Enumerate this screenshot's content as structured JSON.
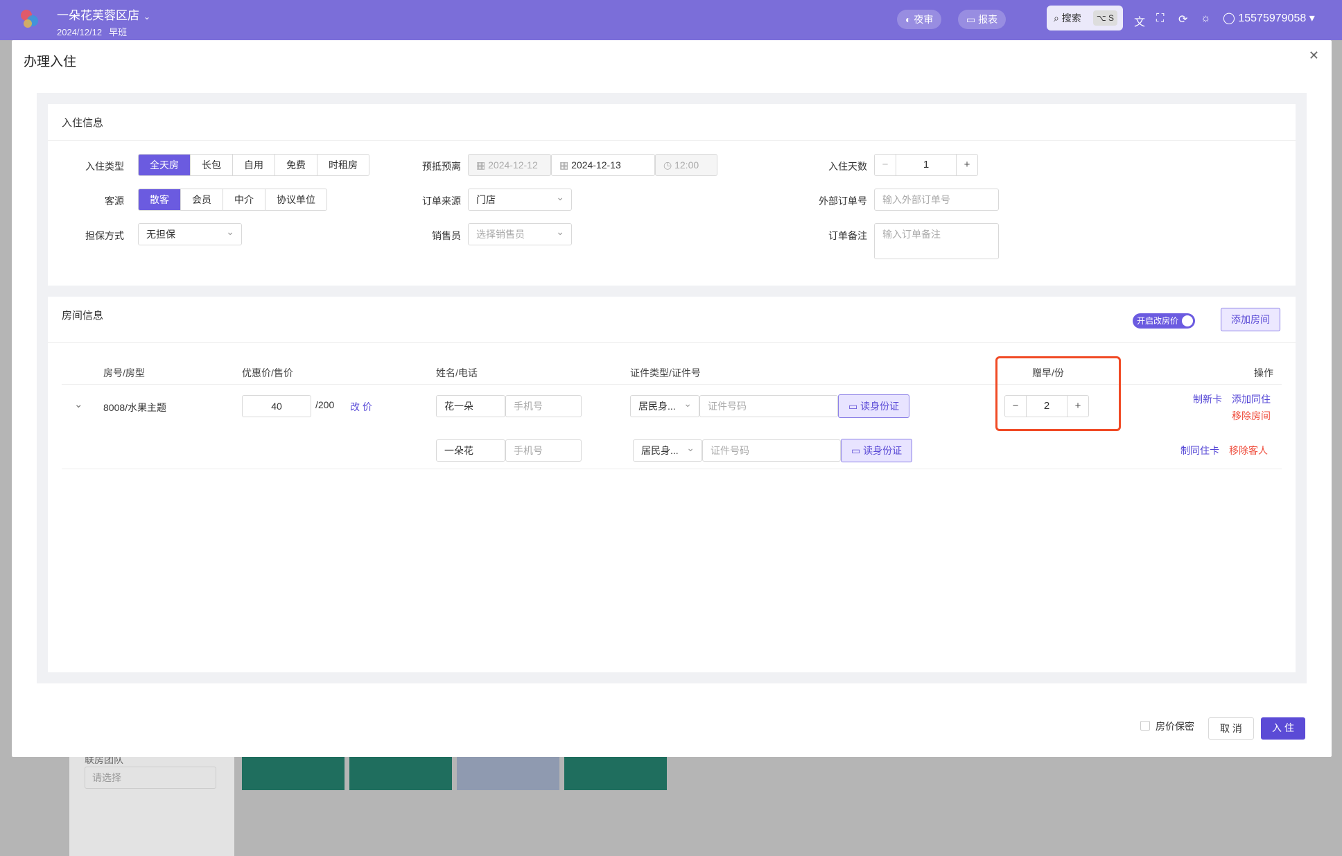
{
  "topbar": {
    "store_name": "一朵花芙蓉区店",
    "date": "2024/12/12",
    "shift": "早班",
    "night_audit_label": "夜审",
    "report_label": "报表",
    "search_label": "搜索",
    "search_shortcut": "⌥ S",
    "user_phone": "15575979058"
  },
  "background": {
    "dropdown_label": "联房团队",
    "dropdown_placeholder": "请选择"
  },
  "modal": {
    "title": "办理入住",
    "checkin_section": {
      "title": "入住信息",
      "checkin_type_label": "入住类型",
      "checkin_types": [
        "全天房",
        "长包",
        "自用",
        "免费",
        "时租房"
      ],
      "selected_checkin_type": "全天房",
      "guest_source_label": "客源",
      "guest_sources": [
        "散客",
        "会员",
        "中介",
        "协议单位"
      ],
      "selected_guest_source": "散客",
      "guarantee_label": "担保方式",
      "guarantee_value": "无担保",
      "stay_dates_label": "预抵预离",
      "arrival_date": "2024-12-12",
      "departure_date": "2024-12-13",
      "departure_time": "12:00",
      "order_source_label": "订单来源",
      "order_source_value": "门店",
      "salesperson_label": "销售员",
      "salesperson_placeholder": "选择销售员",
      "stay_days_label": "入住天数",
      "stay_days_value": "1",
      "external_order_label": "外部订单号",
      "external_order_placeholder": "输入外部订单号",
      "order_note_label": "订单备注",
      "order_note_placeholder": "输入订单备注"
    },
    "room_section": {
      "title": "房间信息",
      "modify_price_toggle_label": "开启改房价",
      "add_room_label": "添加房间",
      "columns": [
        "房号/房型",
        "优惠价/售价",
        "姓名/电话",
        "证件类型/证件号",
        "赠早/份",
        "操作"
      ],
      "room": {
        "room_name": "8008/水果主题",
        "discount_price": "40",
        "sale_price": "/200",
        "change_price_label": "改 价",
        "breakfast_count": "2",
        "make_new_card_label": "制新卡",
        "add_cohabitant_label": "添加同住",
        "remove_room_label": "移除房间"
      },
      "guests": [
        {
          "name": "花一朵",
          "phone_placeholder": "手机号",
          "id_type": "居民身...",
          "id_placeholder": "证件号码",
          "read_id_label": "读身份证"
        },
        {
          "name": "一朵花",
          "phone_placeholder": "手机号",
          "id_type": "居民身...",
          "id_placeholder": "证件号码",
          "read_id_label": "读身份证",
          "make_card_label": "制同住卡",
          "remove_guest_label": "移除客人"
        }
      ]
    },
    "footer": {
      "price_secret_label": "房价保密",
      "cancel_label": "取 消",
      "checkin_label": "入 住"
    }
  }
}
